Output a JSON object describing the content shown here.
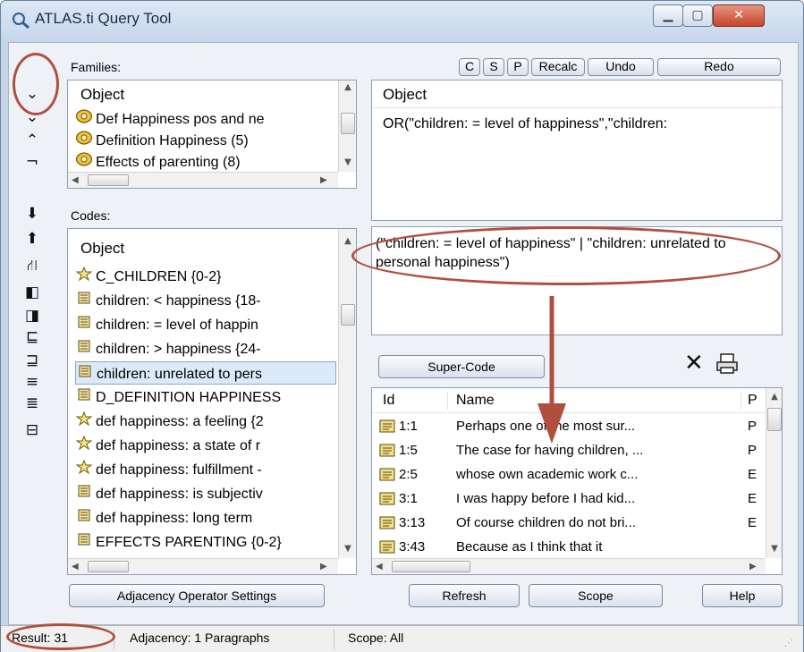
{
  "window": {
    "title": "ATLAS.ti Query Tool",
    "minimize": "▁",
    "maximize": "▢",
    "close": "✕"
  },
  "toolbar": {
    "buttons": [
      {
        "name": "chevron-down-icon",
        "glyph": "⌄"
      },
      {
        "name": "chevron-down-icon",
        "glyph": "⌄"
      },
      {
        "name": "chevron-up-icon",
        "glyph": "⌃"
      },
      {
        "name": "not-operator-icon",
        "glyph": "¬"
      },
      {
        "name": "arrow-down-icon",
        "glyph": "⬇"
      },
      {
        "name": "arrow-up-icon",
        "glyph": "⬆"
      },
      {
        "name": "tree-icon",
        "glyph": "⛙"
      },
      {
        "name": "within-icon",
        "glyph": "◧"
      },
      {
        "name": "encloses-icon",
        "glyph": "◨"
      },
      {
        "name": "overlapped-by-icon",
        "glyph": "⊑"
      },
      {
        "name": "overlaps-icon",
        "glyph": "⊒"
      },
      {
        "name": "follows-icon",
        "glyph": "≡"
      },
      {
        "name": "precedes-icon",
        "glyph": "≣"
      },
      {
        "name": "co-occur-icon",
        "glyph": "⊟"
      }
    ]
  },
  "families": {
    "label": "Families:",
    "header": "Object",
    "items": [
      {
        "icon": "family-icon",
        "text": "Def Happiness pos and ne"
      },
      {
        "icon": "family-icon",
        "text": "Definition Happiness (5)"
      },
      {
        "icon": "family-icon",
        "text": "Effects of parenting (8)"
      }
    ]
  },
  "codes": {
    "label": "Codes:",
    "header": "Object",
    "items": [
      {
        "icon": "code-icon",
        "text": "C_CHILDREN {0-2}",
        "selected": false
      },
      {
        "icon": "supercode-icon",
        "text": "children: < happiness {18-",
        "selected": false
      },
      {
        "icon": "supercode-icon",
        "text": "children: = level of happin",
        "selected": false
      },
      {
        "icon": "supercode-icon",
        "text": "children: > happiness {24-",
        "selected": false
      },
      {
        "icon": "supercode-icon",
        "text": "children: unrelated to pers",
        "selected": true
      },
      {
        "icon": "supercode-icon",
        "text": "D_DEFINITION HAPPINESS",
        "selected": false
      },
      {
        "icon": "code-icon",
        "text": "def happiness: a feeling {2",
        "selected": false
      },
      {
        "icon": "code-icon",
        "text": "def happiness: a state of r",
        "selected": false
      },
      {
        "icon": "code-icon",
        "text": "def happiness: fulfillment -",
        "selected": false
      },
      {
        "icon": "supercode-icon",
        "text": "def happiness: is subjectiv",
        "selected": false
      },
      {
        "icon": "supercode-icon",
        "text": "def happiness: long term",
        "selected": false
      },
      {
        "icon": "supercode-icon",
        "text": "EFFECTS PARENTING {0-2}",
        "selected": false
      }
    ]
  },
  "stack_buttons": {
    "c": "C",
    "s": "S",
    "p": "P",
    "recalc": "Recalc",
    "undo": "Undo",
    "redo": "Redo"
  },
  "query_stack": {
    "header": "Object",
    "item": "OR(\"children: = level of happiness\",\"children:"
  },
  "query_text": "(\"children: = level of happiness\" | \"children: unrelated to personal happiness\")",
  "super_code_label": "Super-Code",
  "results": {
    "headers": [
      "Id",
      "Name",
      "P"
    ],
    "rows": [
      {
        "id": "1:1",
        "name": "Perhaps one of the most sur...",
        "p": "P"
      },
      {
        "id": "1:5",
        "name": "The case for having children, ...",
        "p": "P"
      },
      {
        "id": "2:5",
        "name": "whose own academic work c...",
        "p": "E"
      },
      {
        "id": "3:1",
        "name": "I was happy before I had kid...",
        "p": "E"
      },
      {
        "id": "3:13",
        "name": "Of course children do not bri...",
        "p": "E"
      },
      {
        "id": "3:43",
        "name": "Because as I think that it",
        "p": ""
      }
    ]
  },
  "bottom_buttons": {
    "adjacency": "Adjacency Operator Settings",
    "refresh": "Refresh",
    "scope": "Scope",
    "help": "Help"
  },
  "status": {
    "result": "Result: 31",
    "adjacency": "Adjacency: 1 Paragraphs",
    "scope": "Scope: All"
  },
  "colors": {
    "annotation": "#b14f3f",
    "selection": "#dbe9f8",
    "window_frame": "#c7d6e9"
  }
}
